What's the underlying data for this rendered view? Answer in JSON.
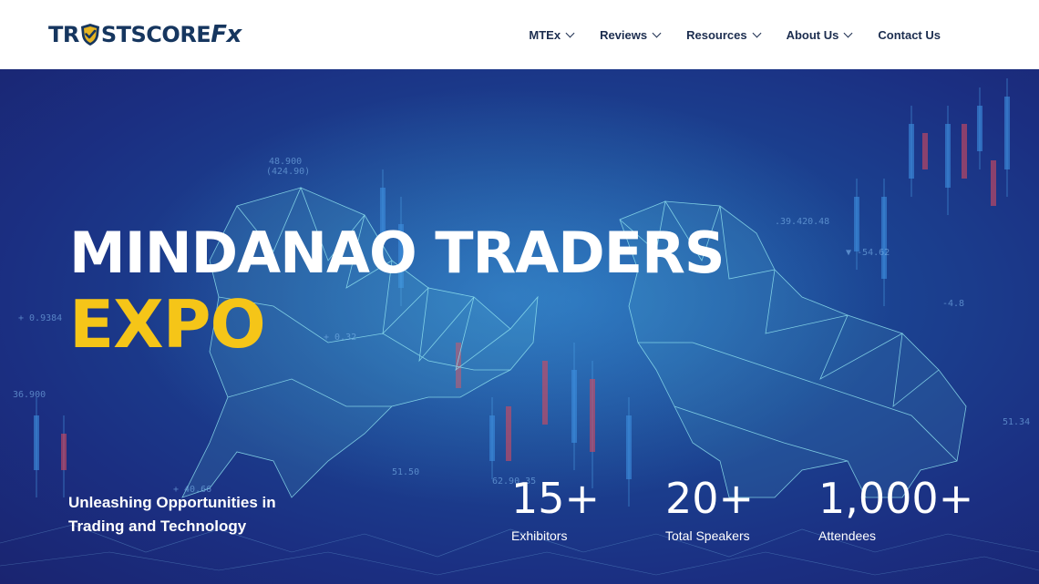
{
  "brand": {
    "logo_text": "TRUSTSCOREFX",
    "logo_part1": "TR",
    "logo_part2": "STSCORE",
    "logo_fx": "Fx"
  },
  "nav": {
    "items": [
      {
        "label": "MTEx",
        "has_dropdown": true
      },
      {
        "label": "Reviews",
        "has_dropdown": true
      },
      {
        "label": "Resources",
        "has_dropdown": true
      },
      {
        "label": "About Us",
        "has_dropdown": true
      },
      {
        "label": "Contact Us",
        "has_dropdown": false
      }
    ]
  },
  "hero": {
    "title_line1": "MINDANAO TRADERS",
    "title_line2": "EXPO",
    "tagline": "Unleashing Opportunities in Trading and Technology",
    "stats": [
      {
        "value": "15+",
        "label": "Exhibitors"
      },
      {
        "value": "20+",
        "label": "Total Speakers"
      },
      {
        "value": "1,000+",
        "label": "Attendees"
      }
    ]
  },
  "colors": {
    "header_bg": "#ffffff",
    "nav_text": "#1c2d4f",
    "hero_bg": "#1b3a8c",
    "accent_yellow": "#f5c518",
    "logo_navy": "#16365f",
    "logo_gold": "#e6b422"
  }
}
